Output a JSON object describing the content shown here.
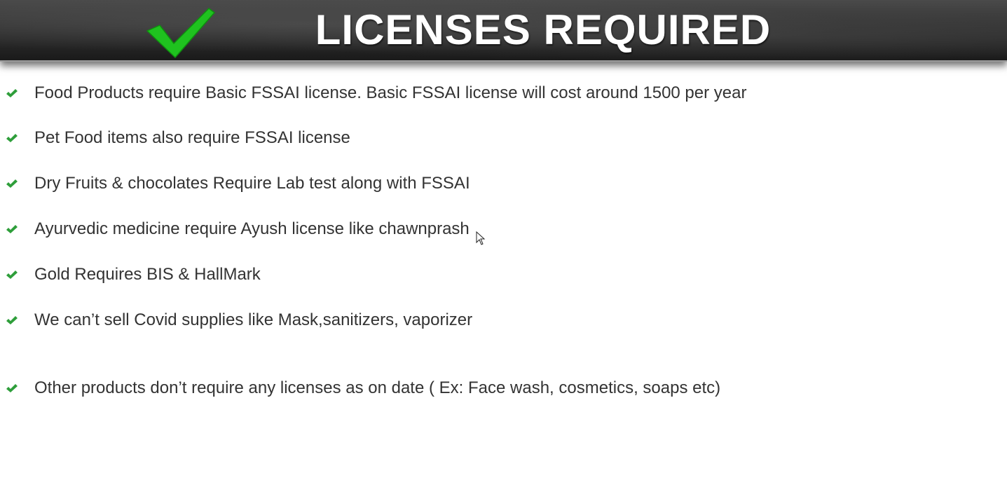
{
  "header": {
    "title": "LICENSES REQUIRED",
    "check_icon": "green-checkmark-icon",
    "check_color": "#1fc21f"
  },
  "bullets": [
    {
      "text": "Food Products require Basic FSSAI license. Basic FSSAI license will cost around 1500 per year"
    },
    {
      "text": "Pet Food items also require FSSAI license"
    },
    {
      "text": "Dry Fruits & chocolates Require Lab test along with FSSAI"
    },
    {
      "text": "Ayurvedic medicine require Ayush license like chawnprash"
    },
    {
      "text": "Gold Requires BIS & HallMark"
    },
    {
      "text": "We can’t sell Covid supplies like Mask,sanitizers, vaporizer"
    },
    {
      "text": "Other products don’t require any licenses as on date ( Ex: Face wash, cosmetics, soaps etc)"
    }
  ],
  "colors": {
    "bullet_tick": "#2e9e3a",
    "text": "#333333",
    "banner": "#2e2e2e"
  }
}
